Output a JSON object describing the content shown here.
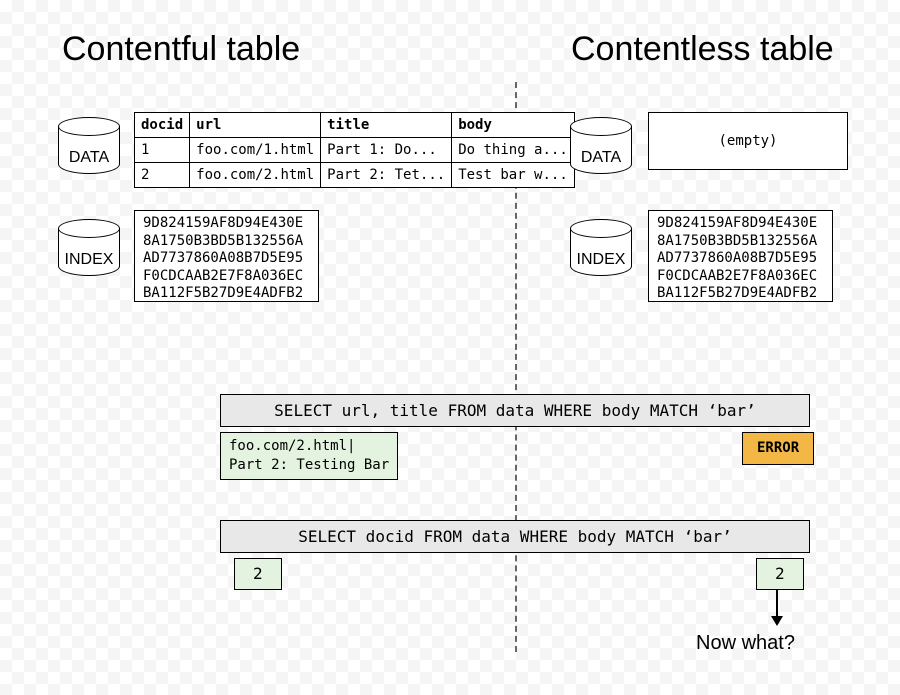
{
  "headings": {
    "left": "Contentful table",
    "right": "Contentless table"
  },
  "cylinders": {
    "data": "DATA",
    "index": "INDEX"
  },
  "empty_label": "(empty)",
  "table": {
    "headers": [
      "docid",
      "url",
      "title",
      "body"
    ],
    "rows": [
      [
        "1",
        "foo.com/1.html",
        "Part 1: Do...",
        "Do thing a..."
      ],
      [
        "2",
        "foo.com/2.html",
        "Part 2: Tet...",
        "Test bar w..."
      ]
    ]
  },
  "index_dump": "9D824159AF8D94E430E\n8A1750B3BD5B132556A\nAD7737860A08B7D5E95\nF0CDCAAB2E7F8A036EC\nBA112F5B27D9E4ADFB2",
  "queries": {
    "q1": "SELECT url, title FROM data WHERE body MATCH ‘bar’",
    "q2": "SELECT docid FROM data WHERE body MATCH ‘bar’"
  },
  "results": {
    "q1_left": "foo.com/2.html|\nPart 2: Testing Bar",
    "q1_right": "ERROR",
    "q2_left": "2",
    "q2_right": "2"
  },
  "now_what": "Now what?"
}
